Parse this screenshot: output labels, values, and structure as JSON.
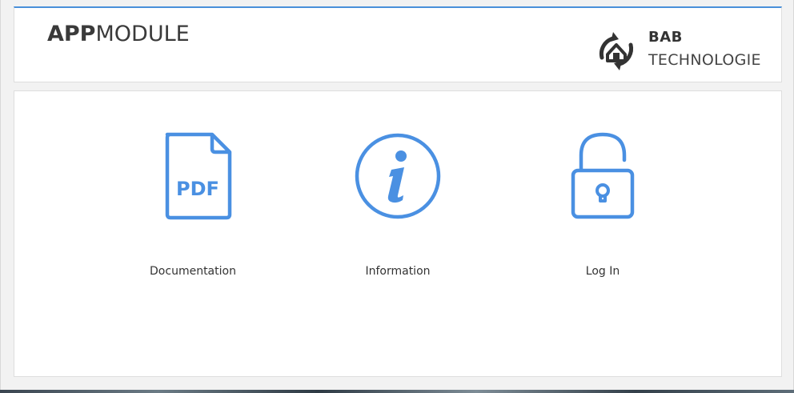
{
  "header": {
    "title_bold": "APP",
    "title_regular": "MODULE",
    "brand_name": "BAB",
    "brand_subtitle": "TECHNOLOGIE"
  },
  "tiles": [
    {
      "label": "Documentation",
      "icon": "pdf-document-icon",
      "icon_text": "PDF"
    },
    {
      "label": "Information",
      "icon": "info-icon"
    },
    {
      "label": "Log In",
      "icon": "unlocked-padlock-icon"
    }
  ],
  "colors": {
    "accent": "#4a90d9",
    "icon": "#4a90e2",
    "text": "#333333",
    "background": "#f2f2f2"
  }
}
